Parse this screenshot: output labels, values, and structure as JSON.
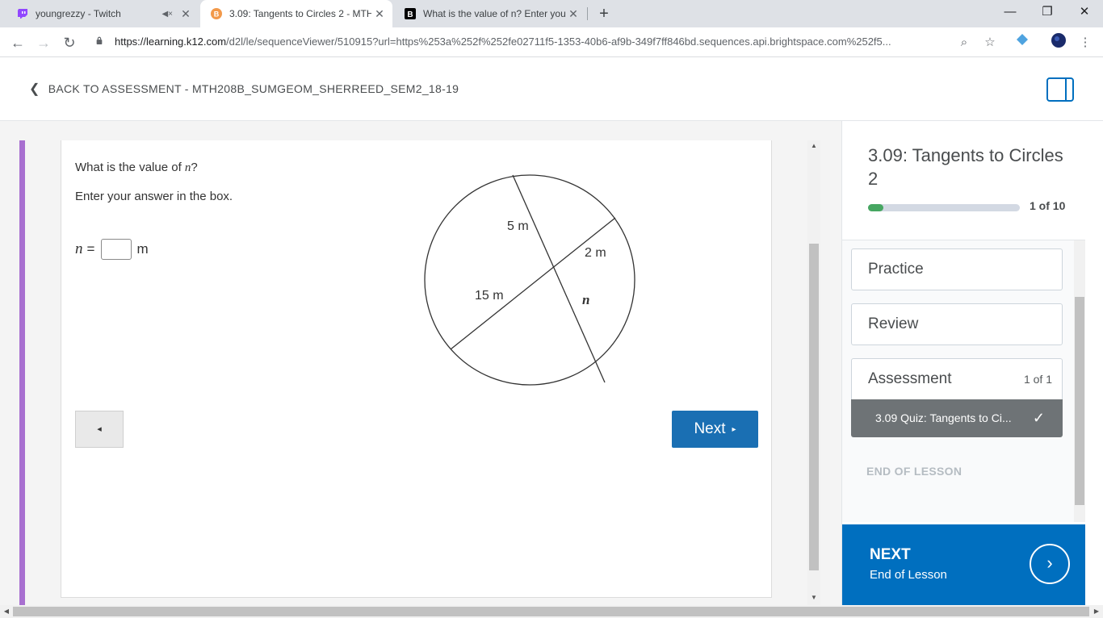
{
  "browser": {
    "tabs": [
      {
        "title": "youngrezzy - Twitch",
        "favicon": "twitch-icon",
        "muted": true
      },
      {
        "title": "3.09: Tangents to Circles 2 - MTH",
        "favicon": "brightspace-icon",
        "active": true
      },
      {
        "title": "What is the value of n? Enter you",
        "favicon": "brainly-icon"
      }
    ],
    "url_host": "https://learning.k12.com",
    "url_path": "/d2l/le/sequenceViewer/510915?url=https%253a%252f%252fe02711f5-1353-40b6-af9b-349f7ff846bd.sequences.api.brightspace.com%252f5..."
  },
  "header": {
    "back_label": "BACK TO ASSESSMENT - MTH208B_SUMGEOM_SHERREED_SEM2_18-19"
  },
  "question": {
    "prompt_prefix": "What is the value of ",
    "prompt_var": "n",
    "prompt_suffix": "?",
    "instruction": "Enter your answer in the box.",
    "answer_var": "n",
    "answer_eq": "=",
    "answer_unit": "m",
    "answer_value": "",
    "figure_labels": {
      "top": "5 m",
      "right": "2 m",
      "left": "15 m",
      "var": "n"
    }
  },
  "nav": {
    "prev_symbol": "◂",
    "next_label": "Next",
    "next_symbol": "▸"
  },
  "sidebar": {
    "title": "3.09: Tangents to Circles 2",
    "progress_text": "1 of 10",
    "progress_fraction": 0.1,
    "progress_color": "#46a661",
    "items": [
      {
        "label": "Practice"
      },
      {
        "label": "Review"
      },
      {
        "label": "Assessment",
        "count": "1 of 1"
      }
    ],
    "active_subitem": "3.09 Quiz: Tangents to Ci...",
    "end_label": "END OF LESSON",
    "next_title": "NEXT",
    "next_subtitle": "End of Lesson"
  },
  "colors": {
    "accent": "#006fbf",
    "purple_bar": "#a86fd0",
    "next_button": "#1a6fb3"
  }
}
